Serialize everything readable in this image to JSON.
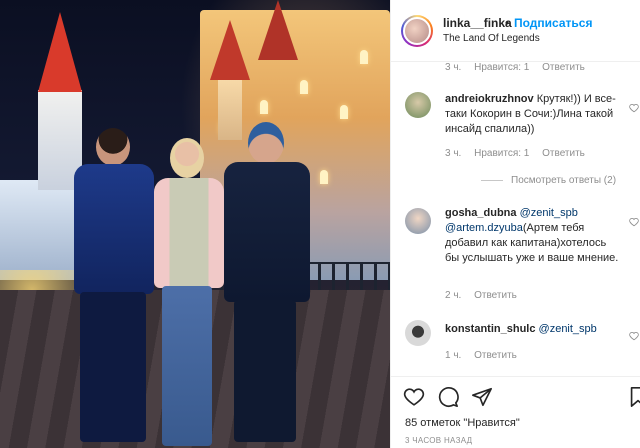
{
  "post": {
    "username": "linka__finka",
    "separator": "•",
    "follow_label": "Подписаться",
    "location": "The Land Of Legends"
  },
  "comments": {
    "top_meta": {
      "time": "3 ч.",
      "likes": "Нравится: 1",
      "reply": "Ответить"
    },
    "items": [
      {
        "username": "andreiokruzhnov",
        "text": "Крутяк!)) И все-таки Кокорин в Сочи:)Лина такой инсайд спалила))",
        "time": "3 ч.",
        "likes": "Нравится: 1",
        "reply": "Ответить"
      },
      {
        "username": "gosha_dubna",
        "mention1": "@zenit_spb",
        "mention2": "@artem.dzyuba",
        "text": "(Артем тебя добавил как капитана)хотелось бы услышать уже и ваше мнение.",
        "time": "2 ч.",
        "reply": "Ответить"
      },
      {
        "username": "konstantin_shulc",
        "mention1": "@zenit_spb",
        "time": "1 ч.",
        "reply": "Ответить"
      }
    ],
    "view_replies": "Посмотреть ответы (2)"
  },
  "actions": {
    "like_icon": "heart-outline-icon",
    "comment_icon": "comment-bubble-icon",
    "share_icon": "paper-plane-icon",
    "likes_text": "85 отметок \"Нравится\"",
    "time_ago": "3 ЧАСОВ НАЗАД"
  },
  "colors": {
    "link": "#0095f6",
    "mention": "#00376b",
    "muted": "#8e8e8e"
  }
}
